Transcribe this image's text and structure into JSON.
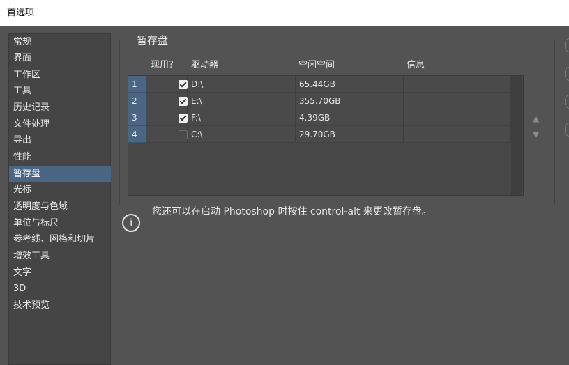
{
  "window": {
    "title": "首选项"
  },
  "sidebar": {
    "items": [
      {
        "label": "常规"
      },
      {
        "label": "界面"
      },
      {
        "label": "工作区"
      },
      {
        "label": "工具"
      },
      {
        "label": "历史记录"
      },
      {
        "label": "文件处理"
      },
      {
        "label": "导出"
      },
      {
        "label": "性能"
      },
      {
        "label": "暂存盘",
        "active": true
      },
      {
        "label": "光标"
      },
      {
        "label": "透明度与色域"
      },
      {
        "label": "单位与标尺"
      },
      {
        "label": "参考线、网格和切片"
      },
      {
        "label": "增效工具"
      },
      {
        "label": "文字"
      },
      {
        "label": "3D"
      },
      {
        "label": "技术预览"
      }
    ]
  },
  "scratch": {
    "group_title": "暂存盘",
    "columns": {
      "active": "现用?",
      "drive": "驱动器",
      "free": "空闲空间",
      "info": "信息"
    },
    "rows": [
      {
        "num": "1",
        "checked": true,
        "drive": "D:\\",
        "free": "65.44GB",
        "info": ""
      },
      {
        "num": "2",
        "checked": true,
        "drive": "E:\\",
        "free": "355.70GB",
        "info": ""
      },
      {
        "num": "3",
        "checked": true,
        "drive": "F:\\",
        "free": "4.39GB",
        "info": ""
      },
      {
        "num": "4",
        "checked": false,
        "drive": "C:\\",
        "free": "29.70GB",
        "info": ""
      }
    ],
    "up_arrow": "▲",
    "down_arrow": "▼",
    "info_icon": "i",
    "info_text": "您还可以在启动 Photoshop 时按住 control-alt 来更改暂存盘。"
  }
}
